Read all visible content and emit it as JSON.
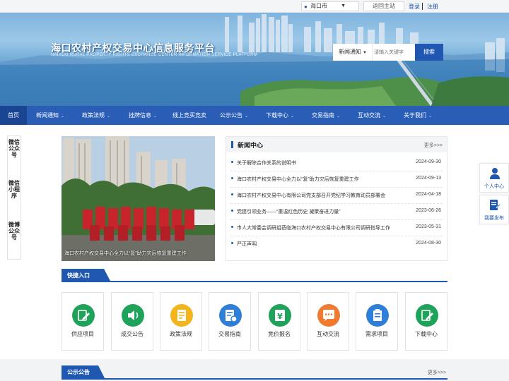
{
  "topbar": {
    "city": "海口市",
    "home_link": "返回主站",
    "login": "登录",
    "register": "注册"
  },
  "header": {
    "title": "海口农村产权交易中心信息服务平台",
    "subtitle": "HAIKOU RURAL PROPERTY RIGHTS EXCHANGE CENTER INFORMATION SERVICE PLATFORM"
  },
  "search": {
    "category": "新闻通知",
    "placeholder": "请输入关键字",
    "button": "搜索"
  },
  "nav": {
    "items": [
      {
        "label": "首页"
      },
      {
        "label": "新闻通知"
      },
      {
        "label": "政策法规"
      },
      {
        "label": "挂牌信息"
      },
      {
        "label": "线上竞买竞卖"
      },
      {
        "label": "公示公告"
      },
      {
        "label": "下载中心"
      },
      {
        "label": "交易指南"
      },
      {
        "label": "互动交流"
      },
      {
        "label": "关于我们"
      }
    ]
  },
  "left_float": {
    "items": [
      {
        "label": "微信公众号"
      },
      {
        "label": "微信小程序"
      },
      {
        "label": "微博公众号"
      }
    ]
  },
  "right_float": {
    "personal_center": "个人中心",
    "publish": "我要发布"
  },
  "photo": {
    "caption": "海口农村产权交易中心全力以“复”助力灾后恢复重建工作"
  },
  "news": {
    "title": "新闻中心",
    "more": "更多>>>",
    "items": [
      {
        "title": "关于解除合作关系的说明书",
        "date": "2024-09-30"
      },
      {
        "title": "海口农村产权交易中心全力以“复”助力灾后恢复重建工作",
        "date": "2024-09-13"
      },
      {
        "title": "海口农村产权交易中心有限公司党支部召开党纪学习教育动员部署会",
        "date": "2024-04-18"
      },
      {
        "title": "党建引领业务——“重温红色历史 凝聚奋进力量”",
        "date": "2023-06-26"
      },
      {
        "title": "市人大常委会调研组莅临海口农村产权交易中心有限公司调研指导工作",
        "date": "2023-05-31"
      },
      {
        "title": "严正声明",
        "date": "2024-08-30"
      }
    ]
  },
  "quick_entry": {
    "title": "快捷入口",
    "items": [
      {
        "label": "供应项目",
        "icon": "edit-icon",
        "color": "#1fa35b"
      },
      {
        "label": "成交公告",
        "icon": "speaker-icon",
        "color": "#1fa35b"
      },
      {
        "label": "政策法规",
        "icon": "document-icon",
        "color": "#f3b51b"
      },
      {
        "label": "交易指南",
        "icon": "guide-icon",
        "color": "#2f7fd8"
      },
      {
        "label": "竞价报名",
        "icon": "yen-icon",
        "color": "#1fa35b"
      },
      {
        "label": "互动交流",
        "icon": "chat-icon",
        "color": "#f07a2f"
      },
      {
        "label": "需求项目",
        "icon": "clipboard-icon",
        "color": "#2f7fd8"
      },
      {
        "label": "下载中心",
        "icon": "download-icon",
        "color": "#1fa35b"
      }
    ]
  },
  "notice": {
    "title": "公示公告",
    "more": "更多>>>"
  },
  "colors": {
    "primary": "#1f57b1",
    "nav": "#2a5db5",
    "nav_active": "#1a4592"
  }
}
